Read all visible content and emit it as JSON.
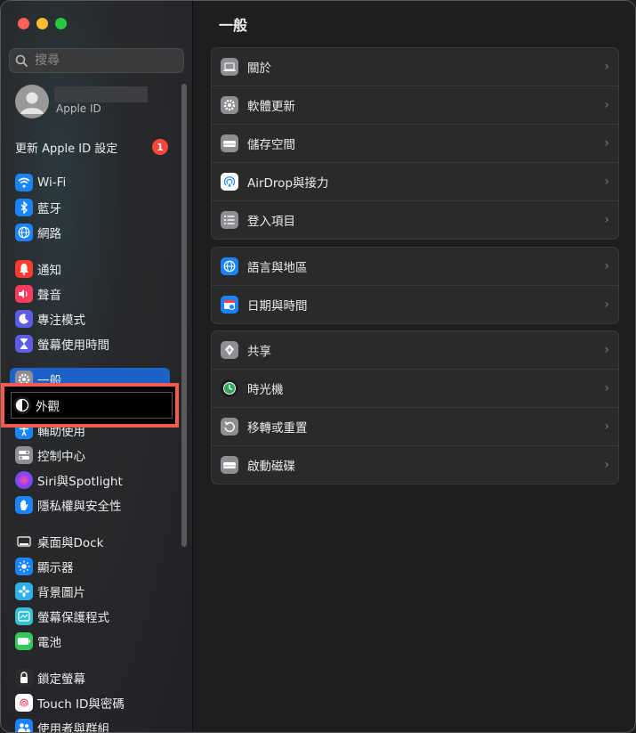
{
  "search": {
    "placeholder": "搜尋"
  },
  "profile": {
    "subtitle": "Apple ID"
  },
  "update": {
    "label": "更新 Apple ID 設定",
    "badge": "1"
  },
  "sidebar": {
    "items": [
      {
        "label": "Wi-Fi",
        "icon": "wifi-icon",
        "color": "#1a84ff"
      },
      {
        "label": "藍牙",
        "icon": "bluetooth-icon",
        "color": "#1a84ff"
      },
      {
        "label": "網路",
        "icon": "globe-icon",
        "color": "#1a84ff"
      },
      {
        "label": "通知",
        "icon": "bell-icon",
        "color": "#ff3b30"
      },
      {
        "label": "聲音",
        "icon": "speaker-icon",
        "color": "#ff3b5c"
      },
      {
        "label": "專注模式",
        "icon": "moon-icon",
        "color": "#5e5ce6"
      },
      {
        "label": "螢幕使用時間",
        "icon": "hourglass-icon",
        "color": "#5e5ce6"
      },
      {
        "label": "一般",
        "icon": "gear-icon",
        "color": "#8e8e93"
      },
      {
        "label": "外觀",
        "icon": "appearance-icon",
        "color": "#1c1c1e"
      },
      {
        "label": "輔助使用",
        "icon": "accessibility-icon",
        "color": "#1a84ff"
      },
      {
        "label": "控制中心",
        "icon": "control-center-icon",
        "color": "#8e8e93"
      },
      {
        "label": "Siri與Spotlight",
        "icon": "siri-icon",
        "color": "#8a3ff4"
      },
      {
        "label": "隱私權與安全性",
        "icon": "hand-icon",
        "color": "#1a84ff"
      },
      {
        "label": "桌面與Dock",
        "icon": "dock-icon",
        "color": "#2c2c2e"
      },
      {
        "label": "顯示器",
        "icon": "sun-icon",
        "color": "#1a84ff"
      },
      {
        "label": "背景圖片",
        "icon": "flower-icon",
        "color": "#30b0e8"
      },
      {
        "label": "螢幕保護程式",
        "icon": "screensaver-icon",
        "color": "#30c0d0"
      },
      {
        "label": "電池",
        "icon": "battery-icon",
        "color": "#34c759"
      },
      {
        "label": "鎖定螢幕",
        "icon": "lock-icon",
        "color": "#2c2c2e"
      },
      {
        "label": "Touch ID與密碼",
        "icon": "fingerprint-icon",
        "color": "#ffffff"
      },
      {
        "label": "使用者與群組",
        "icon": "users-icon",
        "color": "#1a84ff"
      }
    ]
  },
  "main": {
    "title": "一般",
    "groups": [
      [
        {
          "label": "關於",
          "icon": "laptop-icon"
        },
        {
          "label": "軟體更新",
          "icon": "gear-badge-icon"
        },
        {
          "label": "儲存空間",
          "icon": "drive-icon"
        },
        {
          "label": "AirDrop與接力",
          "icon": "airdrop-icon"
        },
        {
          "label": "登入項目",
          "icon": "list-icon"
        }
      ],
      [
        {
          "label": "語言與地區",
          "icon": "globe-icon"
        },
        {
          "label": "日期與時間",
          "icon": "calendar-clock-icon"
        }
      ],
      [
        {
          "label": "共享",
          "icon": "share-icon"
        },
        {
          "label": "時光機",
          "icon": "time-machine-icon"
        },
        {
          "label": "移轉或重置",
          "icon": "reset-icon"
        },
        {
          "label": "啟動磁碟",
          "icon": "startup-disk-icon"
        }
      ]
    ],
    "chevron": "›"
  }
}
